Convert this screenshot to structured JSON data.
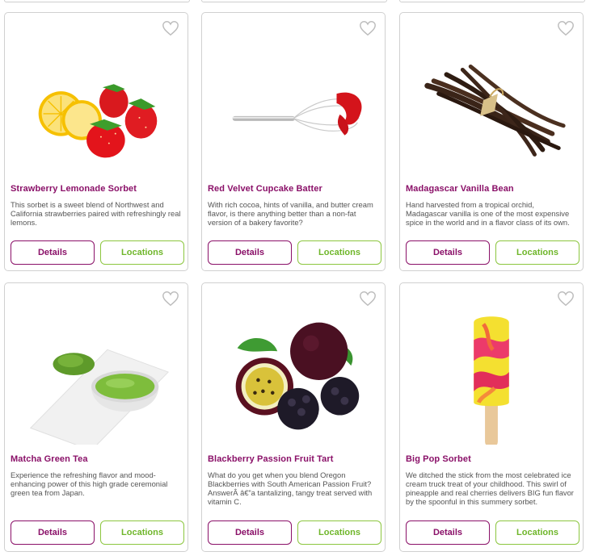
{
  "colors": {
    "title": "#8a1068",
    "details_border": "#8a1068",
    "locations_border": "#8cc63f",
    "heart": "#bdbdbd"
  },
  "products": [
    {
      "title": "Strawberry Lemonade Sorbet",
      "description": "This sorbet is a sweet blend of Northwest and California strawberries paired with refreshingly real lemons.",
      "image": "strawberry-lemon-image",
      "details_label": "Details",
      "locations_label": "Locations"
    },
    {
      "title": "Red Velvet Cupcake Batter",
      "description": "With rich cocoa, hints of vanilla, and butter cream flavor, is there anything better than a non-fat version of a bakery favorite?",
      "image": "red-whisk-image",
      "details_label": "Details",
      "locations_label": "Locations"
    },
    {
      "title": "Madagascar Vanilla Bean",
      "description": "Hand harvested from a tropical orchid, Madagascar vanilla is one of the most expensive spice in the world and in a flavor class of its own.",
      "image": "vanilla-beans-image",
      "details_label": "Details",
      "locations_label": "Locations"
    },
    {
      "title": "Matcha Green Tea",
      "description": "Experience the refreshing flavor and mood-enhancing power of this high grade ceremonial green tea from Japan.",
      "image": "matcha-bowl-image",
      "details_label": "Details",
      "locations_label": "Locations"
    },
    {
      "title": "Blackberry Passion Fruit Tart",
      "description": "What do you get when you blend Oregon Blackberries with South American Passion Fruit? AnswerÂ â€”a tantalizing, tangy treat served with vitamin C.",
      "image": "blackberry-passionfruit-image",
      "details_label": "Details",
      "locations_label": "Locations"
    },
    {
      "title": "Big Pop Sorbet",
      "description": "We ditched the stick from the most celebrated ice cream truck treat of your childhood. This swirl of pineapple and real cherries delivers BIG fun flavor by the spoonful in this summery sorbet.",
      "image": "popsicle-image",
      "details_label": "Details",
      "locations_label": "Locations"
    }
  ]
}
